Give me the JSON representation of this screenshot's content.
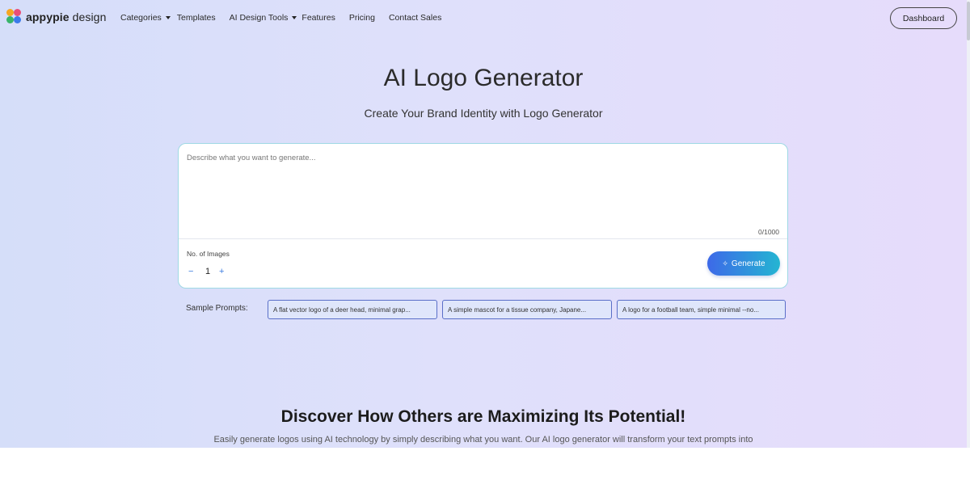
{
  "brand": {
    "name_bold": "appypie",
    "name_light": " design"
  },
  "nav": {
    "items": [
      {
        "label": "Categories",
        "dropdown": true
      },
      {
        "label": "Templates",
        "dropdown": false
      },
      {
        "label": "AI Design Tools",
        "dropdown": true
      },
      {
        "label": "Features",
        "dropdown": false
      },
      {
        "label": "Pricing",
        "dropdown": false
      },
      {
        "label": "Contact Sales",
        "dropdown": false
      }
    ],
    "dashboard_label": "Dashboard"
  },
  "hero": {
    "title": "AI Logo Generator",
    "subtitle": "Create Your Brand Identity with Logo Generator"
  },
  "generator": {
    "prompt_placeholder": "Describe what you want to generate...",
    "prompt_value": "",
    "char_count": "0/1000",
    "images_label": "No. of Images",
    "images_minus": "−",
    "images_value": "1",
    "images_plus": "+",
    "generate_label": "Generate",
    "generate_icon": "sparkle-icon"
  },
  "samples": {
    "label": "Sample Prompts:",
    "chips": [
      "A flat vector logo of a deer head, minimal grap...",
      "A simple mascot for a tissue company, Japane...",
      "A logo for a football team, simple minimal --no..."
    ]
  },
  "section": {
    "title": "Discover How Others are Maximizing Its Potential!",
    "text": "Easily generate logos using AI technology by simply describing what you want. Our AI logo generator will transform your text prompts into"
  },
  "colors": {
    "accent_start": "#3d69e8",
    "accent_end": "#24b5d2",
    "card_border": "#9fd9e4",
    "chip_border": "#5a6fc8"
  }
}
